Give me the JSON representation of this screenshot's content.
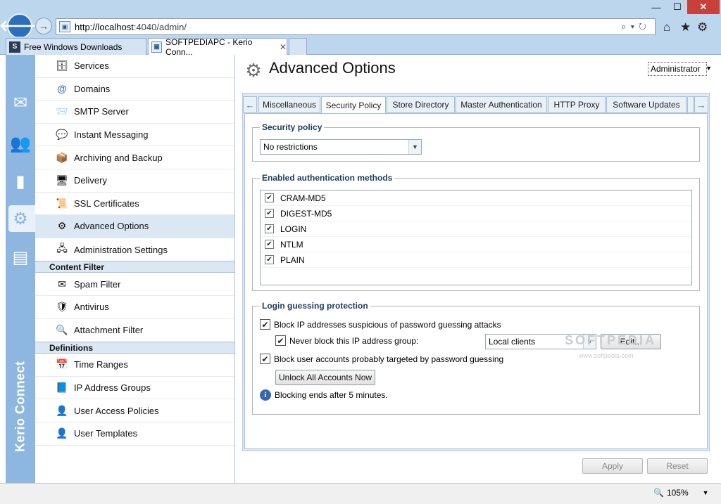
{
  "browser": {
    "url_host": "http://localhost",
    "url_rest": ":4040/admin/",
    "tabs": [
      {
        "label": "Free Windows Downloads",
        "favicon": "S"
      },
      {
        "label": "SOFTPEDIAPC - Kerio Conn...",
        "close": "✕"
      }
    ],
    "zoom": "105%"
  },
  "sidebar": {
    "brand": "Kerio Connect",
    "icons": [
      "mail-icon",
      "users-icon",
      "stats-icon",
      "settings-icon",
      "logs-icon"
    ]
  },
  "nav": {
    "items": [
      {
        "label": "Services",
        "icon": "services-icon"
      },
      {
        "label": "Domains",
        "icon": "at-icon"
      },
      {
        "label": "SMTP Server",
        "icon": "smtp-icon"
      },
      {
        "label": "Instant Messaging",
        "icon": "chat-icon"
      },
      {
        "label": "Archiving and Backup",
        "icon": "archive-icon"
      },
      {
        "label": "Delivery",
        "icon": "delivery-icon"
      },
      {
        "label": "SSL Certificates",
        "icon": "certificate-icon"
      },
      {
        "label": "Advanced Options",
        "icon": "gears-icon"
      },
      {
        "label": "Administration Settings",
        "icon": "admin-icon"
      }
    ],
    "content_filter_header": "Content Filter",
    "content_filter": [
      {
        "label": "Spam Filter",
        "icon": "spam-icon"
      },
      {
        "label": "Antivirus",
        "icon": "antivirus-icon"
      },
      {
        "label": "Attachment Filter",
        "icon": "attachment-icon"
      }
    ],
    "definitions_header": "Definitions",
    "definitions": [
      {
        "label": "Time Ranges",
        "icon": "time-icon"
      },
      {
        "label": "IP Address Groups",
        "icon": "ip-icon"
      },
      {
        "label": "User Access Policies",
        "icon": "policy-icon"
      },
      {
        "label": "User Templates",
        "icon": "template-icon"
      }
    ]
  },
  "header": {
    "title": "Advanced Options",
    "user": "Administrator"
  },
  "tabs": [
    "Miscellaneous",
    "Security Policy",
    "Store Directory",
    "Master Authentication",
    "HTTP Proxy",
    "Software Updates"
  ],
  "security_policy": {
    "legend": "Security policy",
    "value": "No restrictions"
  },
  "auth_methods": {
    "legend": "Enabled authentication methods",
    "items": [
      "CRAM-MD5",
      "DIGEST-MD5",
      "LOGIN",
      "NTLM",
      "PLAIN"
    ]
  },
  "login_protection": {
    "legend": "Login guessing protection",
    "block_ip_label": "Block IP addresses suspicious of password guessing attacks",
    "never_block_label": "Never block this IP address group:",
    "group_value": "Local clients",
    "edit_label": "Edit...",
    "block_accounts_label": "Block user accounts probably targeted by password guessing",
    "unlock_label": "Unlock All Accounts Now",
    "info_text": "Blocking ends after 5 minutes."
  },
  "footer": {
    "apply": "Apply",
    "reset": "Reset"
  },
  "watermark": {
    "text": "SOFTPEDIA",
    "url": "www.softpedia.com"
  }
}
